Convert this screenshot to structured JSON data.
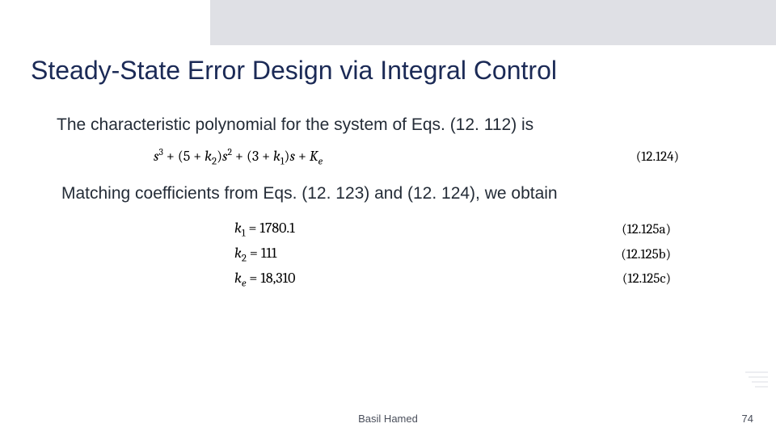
{
  "slide": {
    "title": "Steady-State Error Design via Integral Control",
    "para1": "The characteristic polynomial for the system of Eqs. (12. 112) is",
    "para2": "Matching coefficients from Eqs. (12. 123) and (12. 124), we obtain",
    "author": "Basil Hamed",
    "page_number": "74"
  },
  "eq124": {
    "tag": "(12.124)"
  },
  "eq125": {
    "a_val": "1780.1",
    "a_tag": "(12.125a)",
    "b_val": "111",
    "b_tag": "(12.125b)",
    "c_val": "18,310",
    "c_tag": "(12.125c)"
  }
}
